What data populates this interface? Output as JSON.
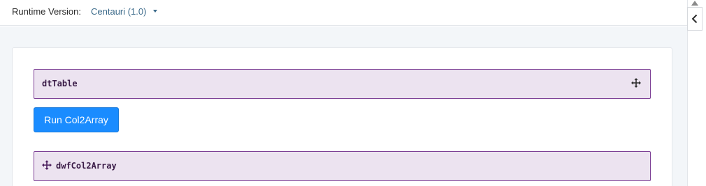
{
  "header": {
    "runtime_label": "Runtime Version:",
    "runtime_value": "Centauri (1.0)"
  },
  "blocks": {
    "dt_table": {
      "label": "dtTable"
    },
    "dwf_col2array": {
      "label": "dwfCol2Array"
    }
  },
  "actions": {
    "run_label": "Run Col2Array"
  },
  "icons": {
    "move": "move-arrows-icon",
    "dropdown": "caret-down-icon",
    "collapse": "chevron-left-icon",
    "scroll_up": "triangle-up-icon"
  },
  "colors": {
    "accent": "#1a8cff",
    "block_bg": "#ece3f0",
    "block_border": "#7c3f95",
    "link": "#3b6a8a"
  }
}
